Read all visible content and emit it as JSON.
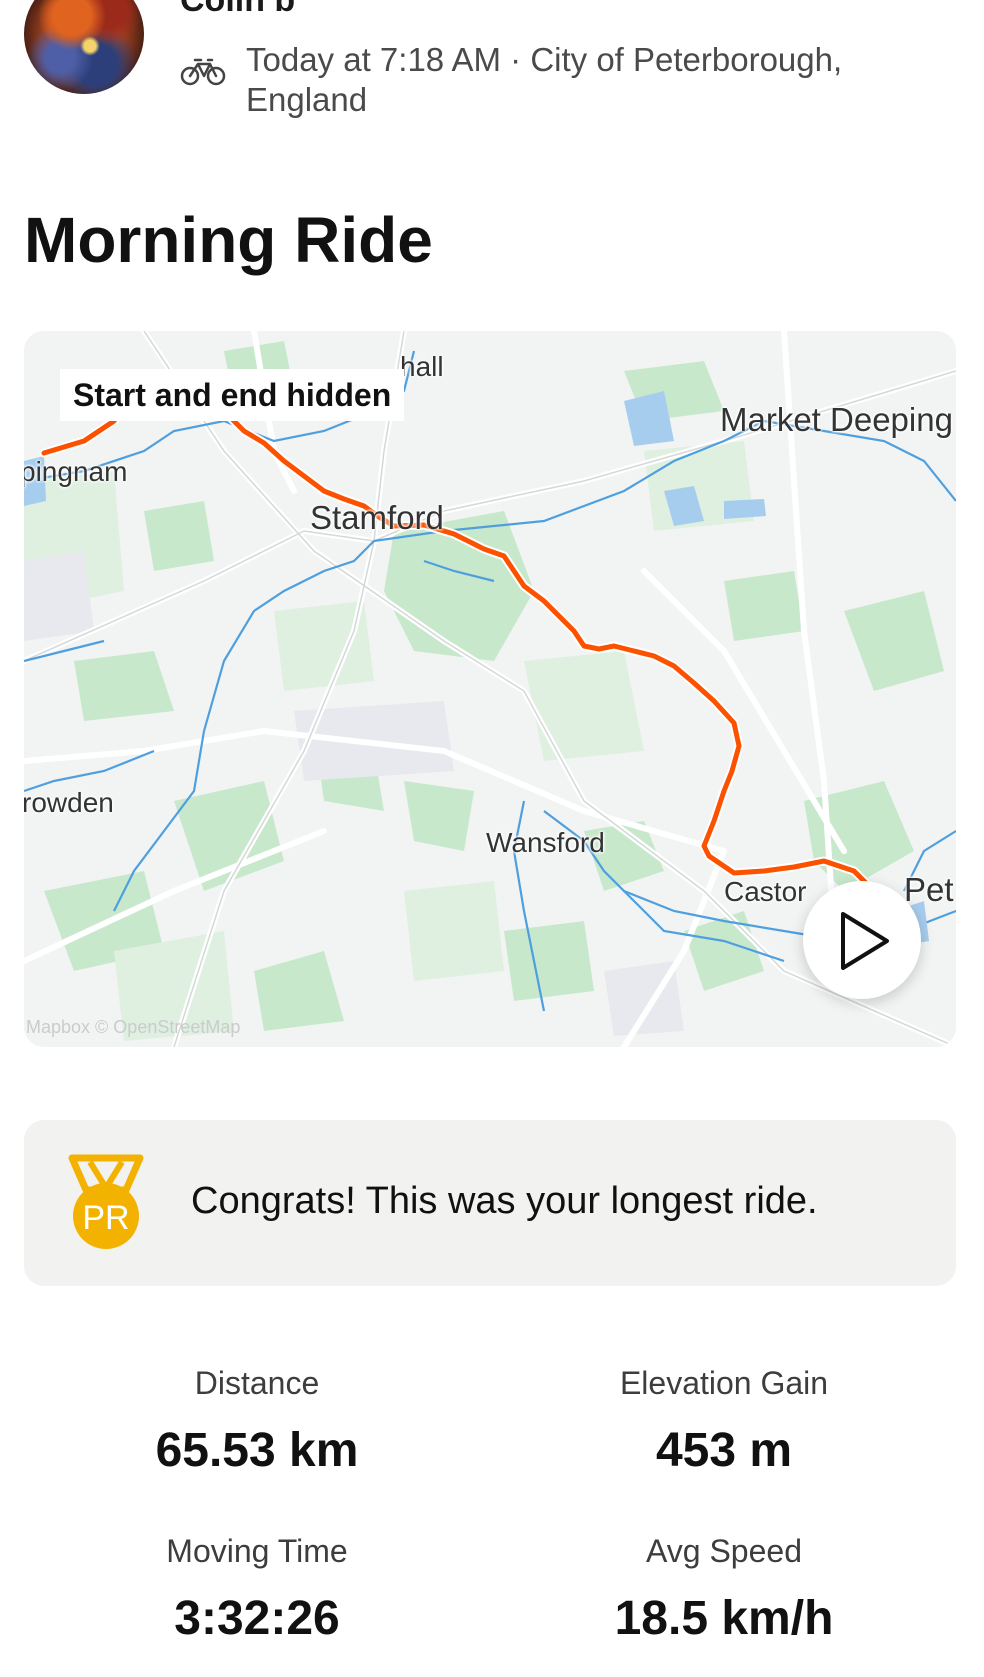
{
  "header": {
    "athlete_name": "Colin b",
    "sport_icon": "bike-icon",
    "meta": "Today at 7:18 AM · City of Peterborough, England"
  },
  "activity": {
    "title": "Morning Ride"
  },
  "map": {
    "privacy_badge": "Start and end hidden",
    "places": {
      "hall": "hall",
      "market_deeping": "Market Deeping",
      "ingham": "pingnam",
      "stamford": "Stamford",
      "rowden": "rowden",
      "wansford": "Wansford",
      "castor": "Castor",
      "peterborough": "Pet"
    },
    "attribution": "Mapbox © OpenStreetMap",
    "route_color": "#fc5200",
    "water_color": "#4f9fde",
    "green_color": "#c8e8cc"
  },
  "achievement": {
    "badge": "PR",
    "text": "Congrats! This was your longest ride.",
    "badge_color": "#f3b200"
  },
  "stats": {
    "distance_label": "Distance",
    "distance_value": "65.53 km",
    "elevation_label": "Elevation Gain",
    "elevation_value": "453 m",
    "moving_time_label": "Moving Time",
    "moving_time_value": "3:32:26",
    "avg_speed_label": "Avg Speed",
    "avg_speed_value": "18.5 km/h"
  }
}
